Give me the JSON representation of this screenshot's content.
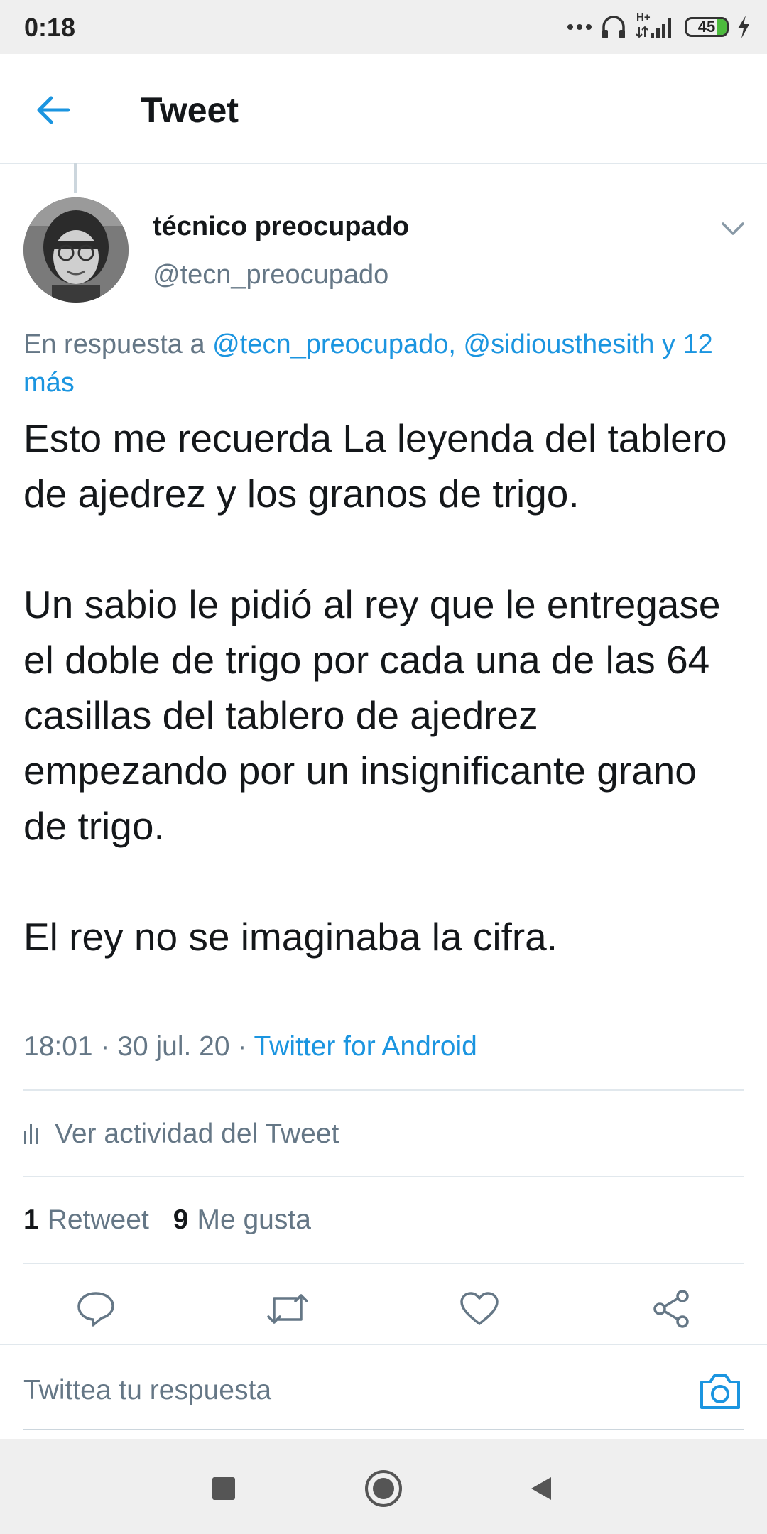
{
  "status_bar": {
    "time": "0:18",
    "network": "H+",
    "battery": "45"
  },
  "header": {
    "title": "Tweet",
    "back_icon": "arrow-left-icon"
  },
  "tweet": {
    "author_name": "técnico preocupado",
    "author_handle": "@tecn_preocupado",
    "reply_prefix": "En respuesta a ",
    "reply_links": "@tecn_preocupado, @sidiousthesith y 12 más",
    "text": "Esto me recuerda La leyenda del tablero de ajedrez y los granos de trigo.\n\nUn sabio le pidió al rey que le entregase el doble de trigo por cada una de las 64 casillas del tablero de ajedrez empezando por un insignificante grano de trigo.\n\nEl rey no se imaginaba la cifra.",
    "time": "18:01 · 30 jul. 20 · ",
    "source": "Twitter for Android",
    "activity_label": "Ver actividad del Tweet",
    "retweets_count": "1",
    "retweets_label": "Retweet",
    "likes_count": "9",
    "likes_label": "Me gusta"
  },
  "reply_bar": {
    "placeholder": "Twittea tu respuesta"
  },
  "colors": {
    "accent": "#1b95e0",
    "secondary_text": "#657786",
    "primary_text": "#14171a",
    "divider": "#e1e8ed"
  }
}
